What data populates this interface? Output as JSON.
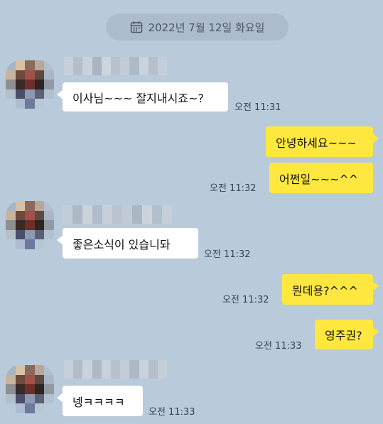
{
  "date_label": "2022년 7월 12일 화요일",
  "messages": [
    {
      "text": "이사님~~~ 잘지내시죠~?",
      "time": "오전 11:31"
    },
    {
      "text": "안녕하세요~~~",
      "time": ""
    },
    {
      "text": "어쩐일~~~^^",
      "time": "오전 11:32"
    },
    {
      "text": "좋은소식이 있습니돠",
      "time": "오전 11:32"
    },
    {
      "text": "뭔데용?^^^",
      "time": "오전 11:32"
    },
    {
      "text": "영주권?",
      "time": "오전 11:33"
    },
    {
      "text": "넹ㅋㅋㅋㅋ",
      "time": "오전 11:33"
    }
  ],
  "colors": {
    "background": "#b9cadb",
    "incoming_bubble": "#ffffff",
    "outgoing_bubble": "#fee83f"
  },
  "icons": {
    "date": "calendar-icon"
  }
}
